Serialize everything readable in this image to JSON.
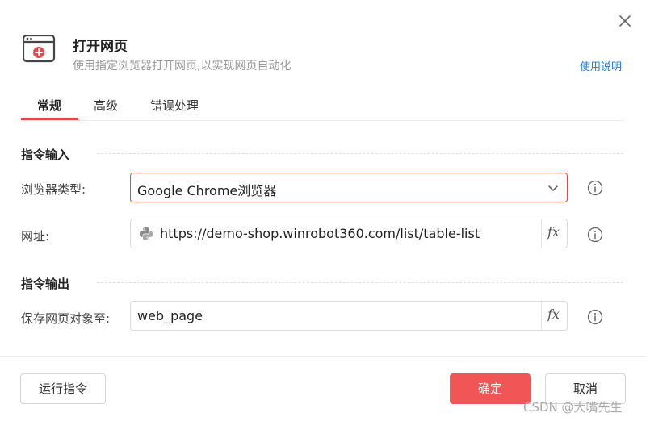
{
  "dialog": {
    "title": "打开网页",
    "description": "使用指定浏览器打开网页,以实现网页自动化",
    "help_link": "使用说明",
    "icons": {
      "header": "browser-add-icon",
      "close": "close-icon"
    }
  },
  "tabs": [
    {
      "label": "常规",
      "active": true
    },
    {
      "label": "高级",
      "active": false
    },
    {
      "label": "错误处理",
      "active": false
    }
  ],
  "sections": {
    "input_title": "指令输入",
    "output_title": "指令输出"
  },
  "fields": {
    "browser_type": {
      "label": "浏览器类型:",
      "value": "Google Chrome浏览器",
      "icon": "chevron-down-icon"
    },
    "url": {
      "label": "网址:",
      "value": "https://demo-shop.winrobot360.com/list/table-list",
      "icon": "python-icon",
      "fx": "fx"
    },
    "save_to": {
      "label": "保存网页对象至:",
      "value": "web_page",
      "fx": "fx"
    }
  },
  "footer": {
    "run_label": "运行指令",
    "ok_label": "确定",
    "cancel_label": "取消"
  },
  "watermark": "CSDN @大嘴先生",
  "colors": {
    "accent": "#e8474a",
    "primary_button": "#f25555",
    "link": "#1e7be0",
    "focus_border": "#e34b4b"
  }
}
